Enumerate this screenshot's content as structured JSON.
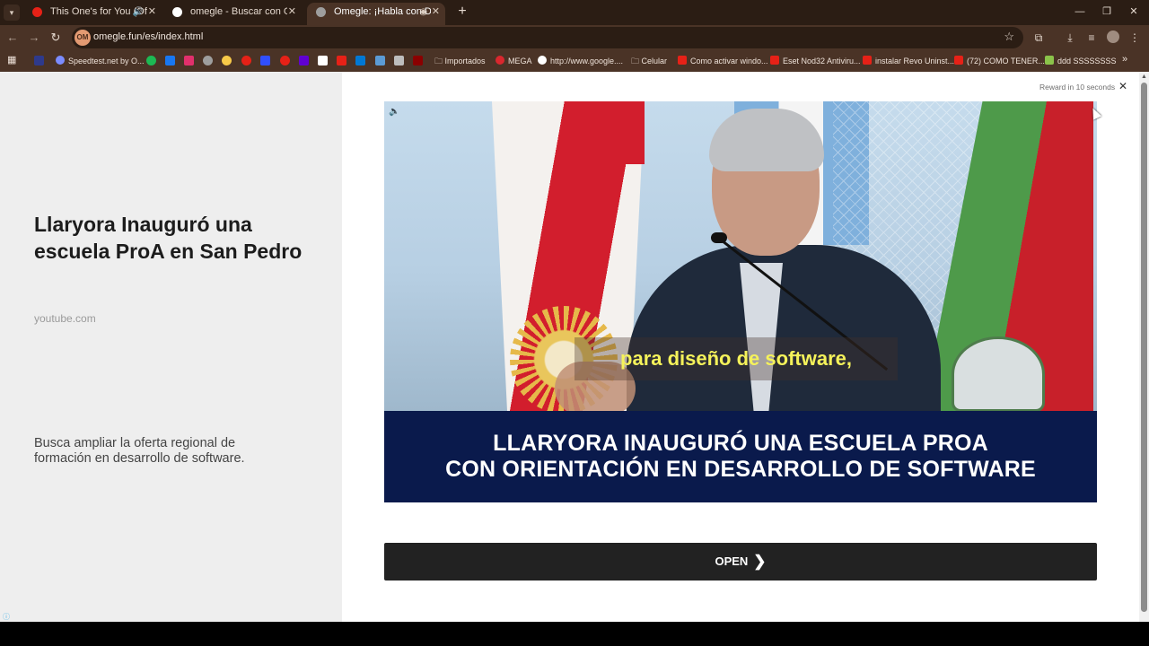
{
  "browser": {
    "tabs": [
      {
        "title": "This One's for You (Official",
        "active": false,
        "favicon_color": "#e62117"
      },
      {
        "title": "omegle - Buscar con Google",
        "active": false,
        "favicon_color": "#ffffff"
      },
      {
        "title": "Omegle: ¡Habla con Descon",
        "active": true,
        "favicon_color": "#9e9e9e"
      }
    ],
    "url": "omegle.fun/es/index.html",
    "site_badge": "OM",
    "bookmarks": [
      {
        "label": "Speedtest.net by O...",
        "color": "#7b8cff"
      },
      {
        "label": "Importados",
        "color": "#e6dad0"
      },
      {
        "label": "MEGA",
        "color": "#d9272e"
      },
      {
        "label": "http://www.google....",
        "color": "#ffffff"
      },
      {
        "label": "Celular",
        "color": "#e6dad0"
      },
      {
        "label": "Como activar windo...",
        "color": "#e62117"
      },
      {
        "label": "Eset Nod32 Antiviru...",
        "color": "#e62117"
      },
      {
        "label": "instalar Revo Uninst...",
        "color": "#e62117"
      },
      {
        "label": "(72) COMO TENER...",
        "color": "#e62117"
      },
      {
        "label": "ddd SSSSSSSS",
        "color": "#8bc34a"
      }
    ],
    "bookmark_icon_colors": [
      "#2e3a8c",
      "#1db954",
      "#1877f2",
      "#e1306c",
      "#9e9e9e",
      "#f7c948",
      "#e62117",
      "#304ffe",
      "#e62117",
      "#6001d2",
      "#ffffff",
      "#e62117",
      "#0078d4",
      "#5b9bd5",
      "#bdbdbd",
      "#8b0000"
    ]
  },
  "ad": {
    "headline": "Llaryora Inauguró una escuela ProA en San Pedro",
    "source": "youtube.com",
    "description": "Busca ampliar la oferta regional de formación en desarrollo de software.",
    "reward_text": "Reward in 10 seconds",
    "open_label": "OPEN",
    "video": {
      "subtitle": "para diseño de software,",
      "banner_line1": "LLARYORA INAUGURÓ UNA ESCUELA PROA",
      "banner_line2": "CON ORIENTACIÓN EN DESARROLLO DE SOFTWARE"
    }
  },
  "colors": {
    "browser_frame": "#4a3326",
    "banner_bg": "#0a1a4c",
    "open_button": "#222222",
    "subtitle_text": "#f5f25a"
  }
}
